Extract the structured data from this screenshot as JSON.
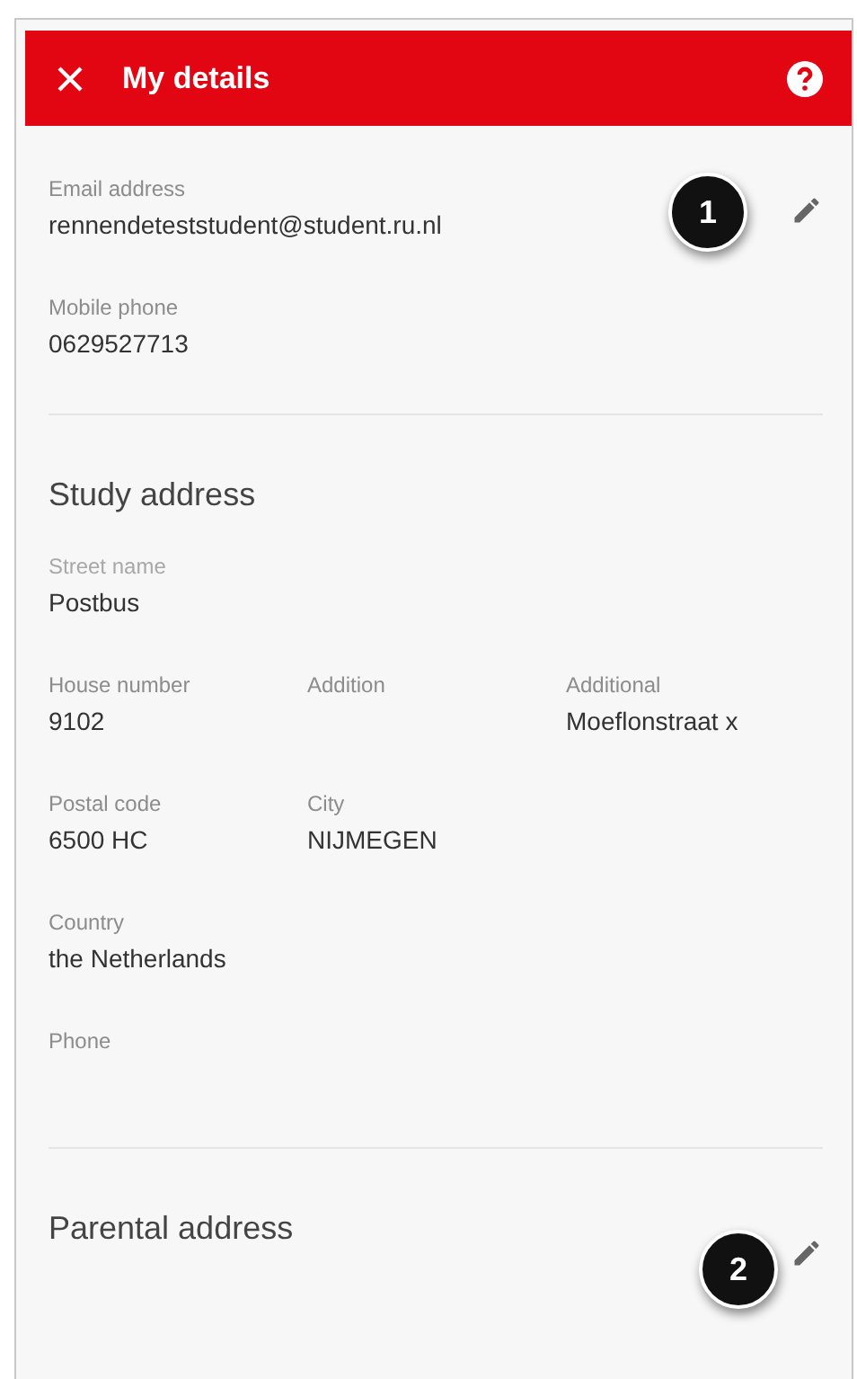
{
  "header": {
    "title": "My details"
  },
  "contact": {
    "annotation": "1",
    "fields": [
      {
        "label": "Email address",
        "value": "rennendeteststudent@student.ru.nl"
      },
      {
        "label": "Mobile phone",
        "value": "0629527713"
      }
    ]
  },
  "sections": [
    {
      "title": "Study address",
      "rows": [
        [
          {
            "label": "Street name",
            "value": "Postbus",
            "faint": true
          }
        ],
        [
          {
            "label": "House number",
            "value": "9102",
            "faint": false
          },
          {
            "label": "Addition",
            "faint": false
          },
          {
            "label": "Additional",
            "value": "Moeflonstraat x",
            "faint": false
          }
        ],
        [
          {
            "label": "Postal code",
            "value": "6500 HC",
            "faint": false
          },
          {
            "label": "City",
            "value": "NIJMEGEN",
            "faint": false
          }
        ],
        [
          {
            "label": "Country",
            "value": "the Netherlands",
            "faint": false
          }
        ],
        [
          {
            "label": "Phone",
            "faint": false
          }
        ]
      ]
    },
    {
      "title": "Parental address",
      "annotation": "2"
    }
  ]
}
